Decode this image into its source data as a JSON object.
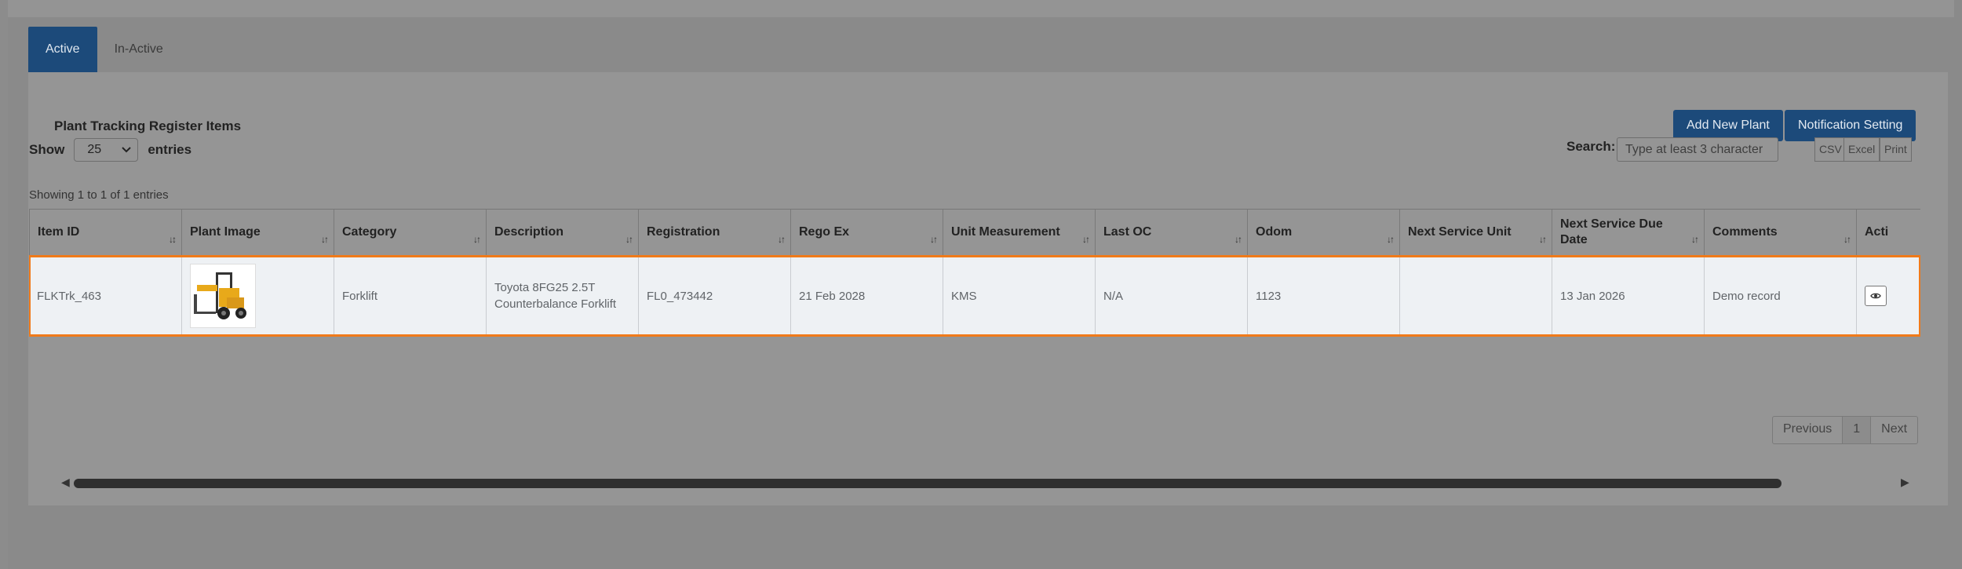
{
  "tabs": [
    {
      "label": "Active"
    },
    {
      "label": "In-Active"
    }
  ],
  "panel": {
    "title": "Plant Tracking Register Items",
    "add_button": "Add New Plant",
    "notif_button": "Notification Setting"
  },
  "controls": {
    "show_label": "Show",
    "entries_value": "25",
    "entries_label": "entries",
    "search_label": "Search:",
    "search_placeholder": "Type at least 3 character",
    "export": [
      "CSV",
      "Excel",
      "Print"
    ]
  },
  "info_text": "Showing 1 to 1 of 1 entries",
  "columns": [
    "Item ID",
    "Plant Image",
    "Category",
    "Description",
    "Registration",
    "Rego Ex",
    "Unit Measurement",
    "Last OC",
    "Odom",
    "Next Service Unit",
    "Next Service Due Date",
    "Comments",
    "Acti"
  ],
  "rows": [
    {
      "item_id": "FLKTrk_463",
      "image": "forklift-image",
      "category": "Forklift",
      "description": "Toyota 8FG25 2.5T Counterbalance Forklift",
      "registration": "FL0_473442",
      "rego_ex": "21 Feb 2028",
      "unit_measurement": "KMS",
      "last_oc": "N/A",
      "odom": "1123",
      "next_service_unit": "",
      "next_service_due": "13 Jan 2026",
      "comments": "Demo record",
      "action_icon": "eye-icon"
    }
  ],
  "pagination": {
    "previous": "Previous",
    "current": "1",
    "next": "Next"
  },
  "colors": {
    "primary": "#1c4a7a",
    "highlight": "#f07a1a",
    "overlay": "#8a8a8a"
  }
}
